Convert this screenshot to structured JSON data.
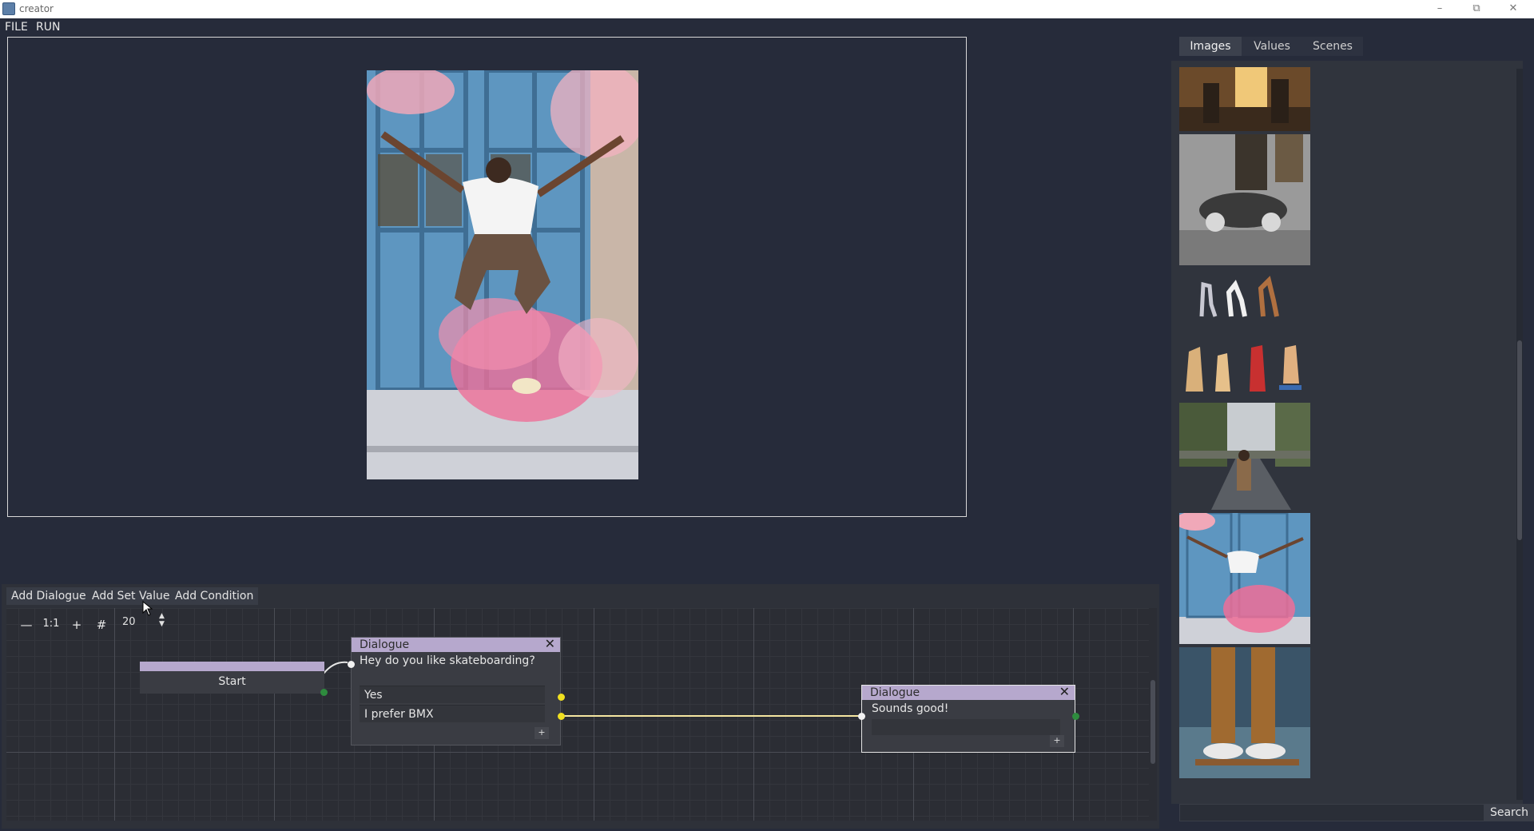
{
  "window": {
    "title": "creator",
    "minimize_glyph": "–",
    "restore_glyph": "⧉",
    "close_glyph": "✕"
  },
  "menu": {
    "file": "FILE",
    "run": "RUN"
  },
  "preview": {
    "image_description_icon": "photo-icon"
  },
  "editor": {
    "toolbar": {
      "add_dialogue": "Add Dialogue",
      "add_set_value": "Add Set Value",
      "add_condition": "Add Condition"
    },
    "zoom": {
      "zoom_out_glyph": "—",
      "reset_glyph": "1:1",
      "zoom_in_glyph": "+",
      "snap_glyph": "#",
      "snap_value": "20"
    },
    "nodes": {
      "start": {
        "label": "Start"
      },
      "dialogue1": {
        "title": "Dialogue",
        "close": "✕",
        "text": "Hey do you like skateboarding?",
        "choices": [
          "Yes",
          "I prefer BMX"
        ],
        "add": "+"
      },
      "dialogue2": {
        "title": "Dialogue",
        "close": "✕",
        "text": "Sounds good!",
        "add": "+"
      }
    },
    "colors": {
      "node_header": "#b6a8cd",
      "port_yellow": "#f0e020",
      "port_green": "#2e8b3e",
      "connection": "#f5e6a0"
    }
  },
  "resources": {
    "tabs": [
      "Images",
      "Values",
      "Scenes"
    ],
    "active_tab": "Images",
    "search_label": "Search",
    "search_value": ""
  }
}
